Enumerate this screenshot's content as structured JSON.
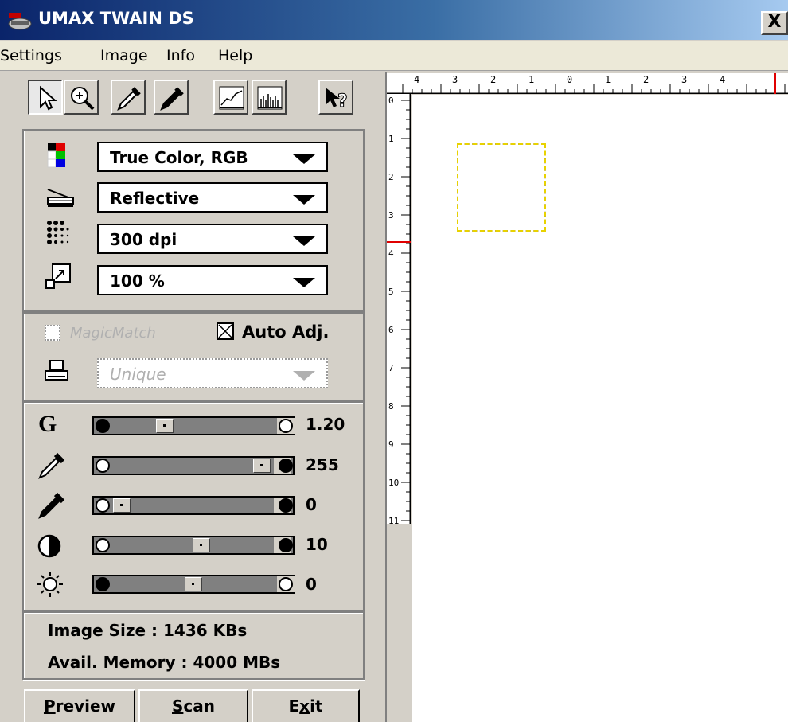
{
  "window": {
    "title": "UMAX TWAIN DS",
    "close_glyph": "X",
    "app_icon": "scanner-app-icon"
  },
  "menu": [
    "Settings",
    "Image",
    "Info",
    "Help"
  ],
  "toolbar": {
    "tools": [
      "pointer-icon",
      "zoom-icon",
      "white-eyedropper-icon",
      "black-eyedropper-icon",
      "curve-icon",
      "histogram-icon",
      "help-pointer-icon"
    ],
    "selected": "pointer-icon"
  },
  "scan_settings": {
    "color_mode": "True Color, RGB",
    "source": "Reflective",
    "resolution": "300 dpi",
    "scale": "100 %"
  },
  "options": {
    "magicmatch_label": "MagicMatch",
    "magicmatch_checked": false,
    "auto_adj_label": "Auto Adj.",
    "auto_adj_checked": true,
    "printer_profile": "Unique"
  },
  "adjustments": {
    "gamma": {
      "icon": "gamma-icon",
      "value": "1.20"
    },
    "highlight": {
      "icon": "white-eyedropper-icon",
      "value": "255"
    },
    "shadow": {
      "icon": "black-eyedropper-icon",
      "value": "0"
    },
    "contrast": {
      "icon": "contrast-icon",
      "value": "10"
    },
    "brightness": {
      "icon": "brightness-icon",
      "value": "0"
    }
  },
  "info": {
    "image_size": "Image Size : 1436 KBs",
    "avail_memory": "Avail. Memory : 4000 MBs"
  },
  "buttons": {
    "preview": {
      "mnemonic": "P",
      "rest": "review"
    },
    "scan": {
      "mnemonic": "S",
      "rest": "can"
    },
    "exit_pre": "E",
    "exit_mnemonic": "x",
    "exit_rest": "it"
  },
  "ruler": {
    "h_labels": [
      "4",
      "3",
      "2",
      "1",
      "0",
      "1",
      "2",
      "3",
      "4"
    ],
    "v_labels": [
      "0",
      "1",
      "2",
      "3",
      "4",
      "5",
      "6",
      "7",
      "8",
      "9",
      "10",
      "11"
    ]
  }
}
